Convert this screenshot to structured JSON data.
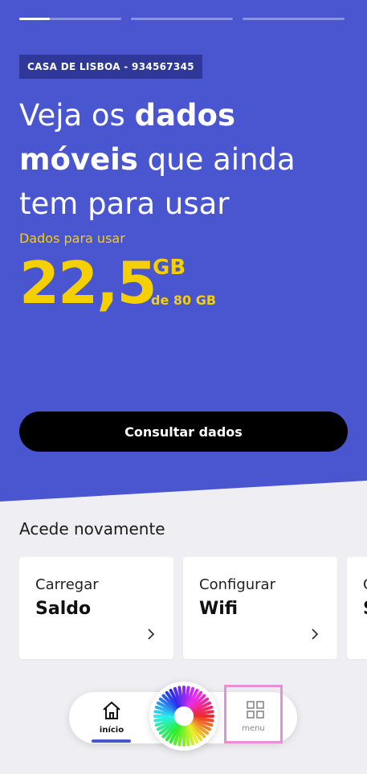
{
  "hero": {
    "stories_progress": [
      0.3,
      0,
      0
    ],
    "account_tag": "CASA DE LISBOA - 934567345",
    "headline_part1": "Veja os ",
    "headline_bold": "dados móveis",
    "headline_part2": " que ainda tem para usar",
    "data_label": "Dados para usar",
    "data_value": "22,5",
    "data_unit": "GB",
    "data_total": "de 80 GB",
    "cta_label": "Consultar dados"
  },
  "quick_access": {
    "title": "Acede novamente",
    "cards": [
      {
        "subtitle": "Carregar",
        "title": "Saldo"
      },
      {
        "subtitle": "Configurar",
        "title": "Wifi"
      },
      {
        "subtitle": "C",
        "title": "S"
      }
    ]
  },
  "bottom_nav": {
    "home_label": "início",
    "menu_label": "menu"
  },
  "colors": {
    "hero_bg": "#4a55d0",
    "accent_yellow": "#f5d000",
    "tag_bg": "#2f3899",
    "highlight_outline": "#e88fd2"
  }
}
